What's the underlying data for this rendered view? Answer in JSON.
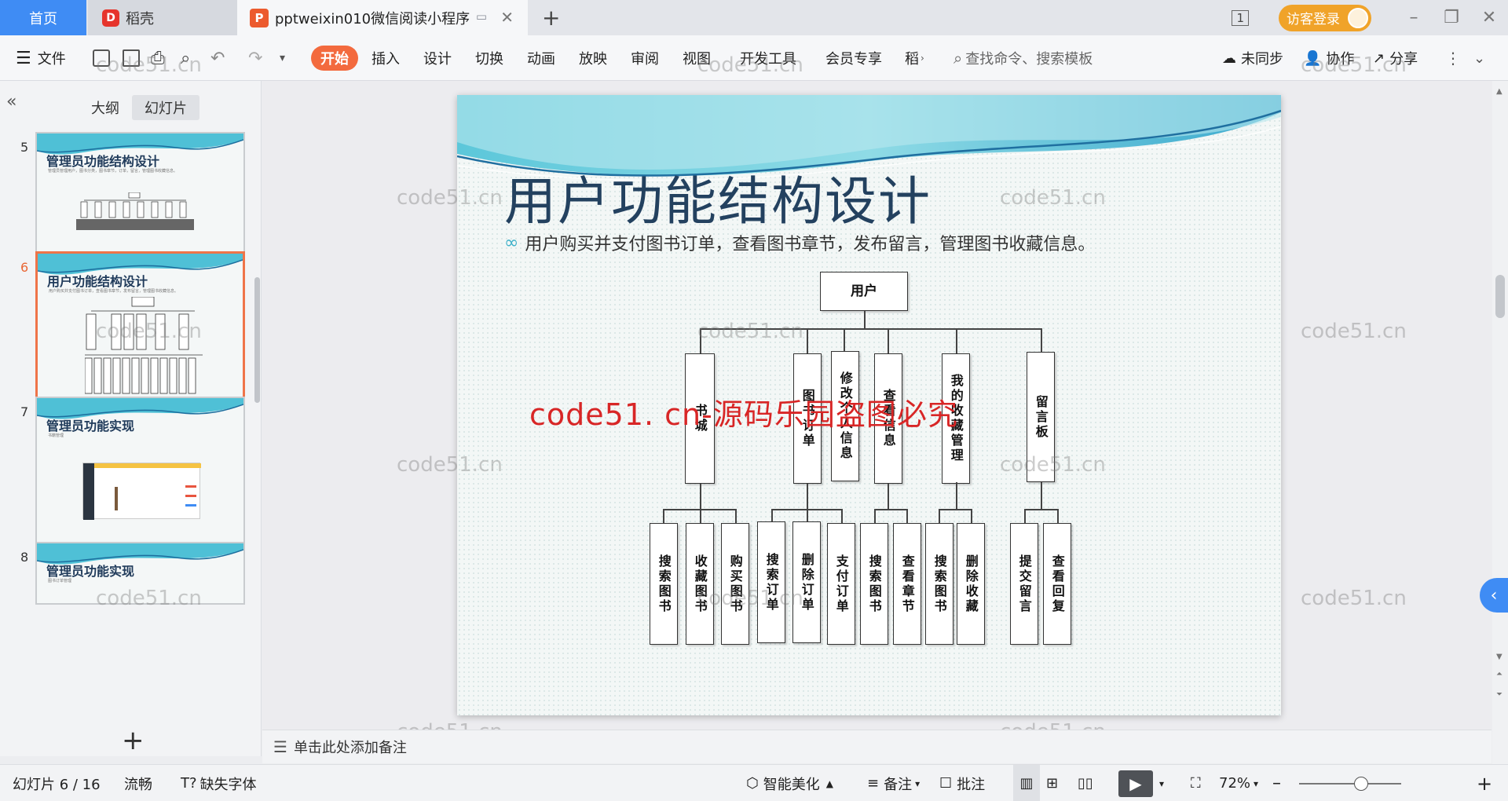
{
  "titlebar": {
    "home_tab": "首页",
    "daoke_tab": "稻壳",
    "doc_tab": "pptweixin010微信阅读小程序",
    "visitor_login": "访客登录",
    "layout_badge": "1"
  },
  "ribbon": {
    "file": "文件",
    "tabs": [
      "开始",
      "插入",
      "设计",
      "切换",
      "动画",
      "放映",
      "审阅",
      "视图",
      "开发工具",
      "会员专享",
      "稻"
    ],
    "search_placeholder": "查找命令、搜索模板",
    "sync": "未同步",
    "collab": "协作",
    "share": "分享"
  },
  "left_panel": {
    "tab_outline": "大纲",
    "tab_slides": "幻灯片",
    "thumbs": [
      {
        "num": "5",
        "title": "管理员功能结构设计",
        "sub": "管理员管理用户，图书分类，图书章节，订单，留言，管理图书收藏信息。"
      },
      {
        "num": "6",
        "title": "用户功能结构设计",
        "sub": "用户购买并支付图书订单，查看图书章节，发布留言，管理图书收藏信息。"
      },
      {
        "num": "7",
        "title": "管理员功能实现",
        "sub": "书籍管理"
      },
      {
        "num": "8",
        "title": "管理员功能实现",
        "sub": "图书订单管理"
      }
    ]
  },
  "slide": {
    "title": "用户功能结构设计",
    "bullet": "用户购买并支付图书订单，查看图书章节，发布留言，管理图书收藏信息。",
    "root": "用户",
    "level1": [
      "书城",
      "图书订单",
      "修改个人信息",
      "查看信息",
      "我的收藏管理",
      "留言板"
    ],
    "level2": [
      "搜索图书",
      "收藏图书",
      "购买图书",
      "搜索订单",
      "删除订单",
      "支付订单",
      "搜索图书",
      "查看章节",
      "搜索图书",
      "删除收藏",
      "提交留言",
      "查看回复"
    ]
  },
  "watermark": {
    "text": "code51.cn",
    "red": "code51. cn-源码乐园盗图必究"
  },
  "notes": {
    "placeholder": "单击此处添加备注"
  },
  "status": {
    "slide_counter": "幻灯片 6 / 16",
    "smooth": "流畅",
    "missing_font": "缺失字体",
    "smart_beauty": "智能美化",
    "notes": "备注",
    "comment": "批注",
    "zoom": "72%"
  }
}
